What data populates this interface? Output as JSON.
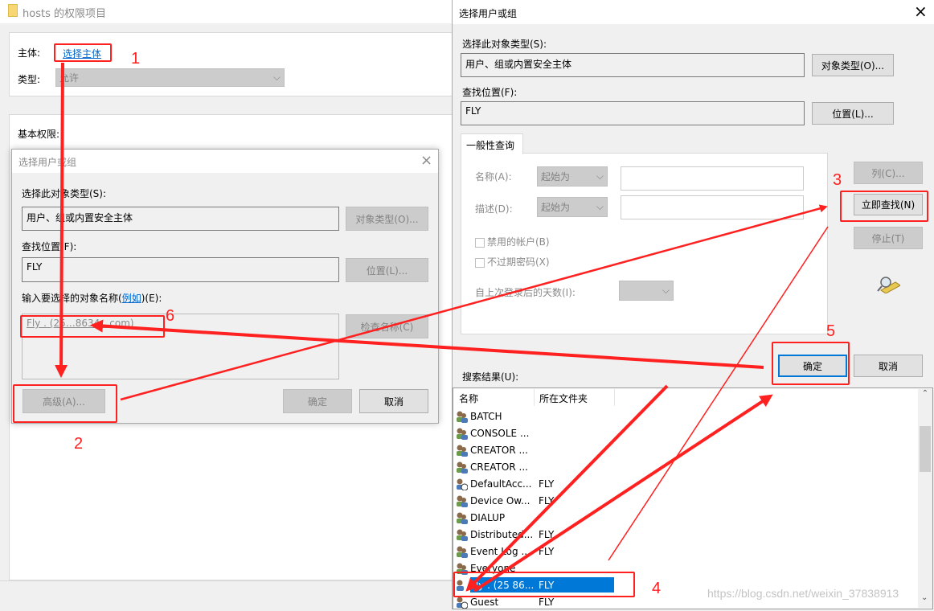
{
  "bg_window": {
    "title": "hosts 的权限项目",
    "principal_label": "主体:",
    "principal_link": "选择主体",
    "type_label": "类型:",
    "type_value": "允许",
    "basic_perms_label": "基本权限:"
  },
  "left_dialog": {
    "title": "选择用户或组",
    "object_type_label": "选择此对象类型(S):",
    "object_type_value": "用户、组或内置安全主体",
    "object_type_btn": "对象类型(O)...",
    "location_label": "查找位置(F):",
    "location_value": "FLY",
    "location_btn": "位置(L)...",
    "enter_label": "输入要选择的对象名称(",
    "enter_link": "例如",
    "enter_label_end": ")(E):",
    "names_value": "Fly . (25…8634…com)",
    "check_names_btn": "检查名称(C)",
    "advanced_btn": "高级(A)...",
    "ok_btn": "确定",
    "cancel_btn": "取消"
  },
  "right_dialog": {
    "title": "选择用户或组",
    "object_type_label": "选择此对象类型(S):",
    "object_type_value": "用户、组或内置安全主体",
    "object_type_btn": "对象类型(O)...",
    "location_label": "查找位置(F):",
    "location_value": "FLY",
    "location_btn": "位置(L)...",
    "tab": "一般性查询",
    "name_label": "名称(A):",
    "name_combo": "起始为",
    "desc_label": "描述(D):",
    "desc_combo": "起始为",
    "disabled_accounts": "禁用的帐户(B)",
    "non_expiring_pw": "不过期密码(X)",
    "days_since_logon": "自上次登录后的天数(I):",
    "columns_btn": "列(C)...",
    "find_now_btn": "立即查找(N)",
    "stop_btn": "停止(T)",
    "ok_btn": "确定",
    "cancel_btn": "取消",
    "results_label": "搜索结果(U):",
    "columns": [
      "名称",
      "所在文件夹"
    ],
    "results": [
      {
        "name": "BATCH",
        "folder": "",
        "icon": "group"
      },
      {
        "name": "CONSOLE ...",
        "folder": "",
        "icon": "group"
      },
      {
        "name": "CREATOR ...",
        "folder": "",
        "icon": "group"
      },
      {
        "name": "CREATOR ...",
        "folder": "",
        "icon": "group"
      },
      {
        "name": "DefaultAcc...",
        "folder": "FLY",
        "icon": "user-disabled"
      },
      {
        "name": "Device Ow...",
        "folder": "FLY",
        "icon": "group"
      },
      {
        "name": "DIALUP",
        "folder": "",
        "icon": "group"
      },
      {
        "name": "Distributed...",
        "folder": "FLY",
        "icon": "group"
      },
      {
        "name": "Event Log ...",
        "folder": "FLY",
        "icon": "group"
      },
      {
        "name": "Everyone",
        "folder": "",
        "icon": "group"
      },
      {
        "name": "Fly . (25 86...",
        "folder": "FLY",
        "icon": "user",
        "selected": true
      },
      {
        "name": "Guest",
        "folder": "FLY",
        "icon": "user-disabled"
      }
    ]
  },
  "annotations": {
    "steps": [
      "1",
      "2",
      "3",
      "4",
      "5",
      "6"
    ],
    "color": "#ff2020"
  },
  "watermark": "https://blog.csdn.net/weixin_37838913",
  "colors": {
    "selection": "#0078d7",
    "link": "#0066cc",
    "annotation": "#ff2020"
  }
}
